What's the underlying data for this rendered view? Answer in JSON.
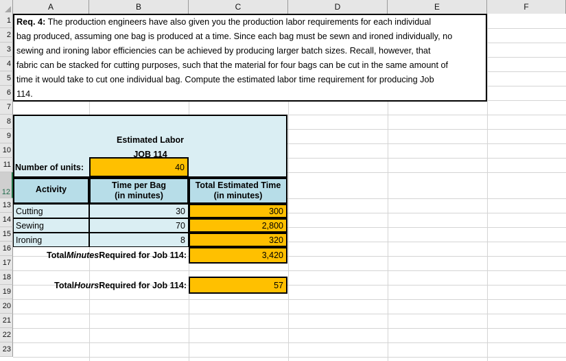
{
  "spreadsheet": {
    "column_headers": [
      "A",
      "B",
      "C",
      "D",
      "E",
      "F"
    ],
    "row_headers": [
      "1",
      "2",
      "3",
      "4",
      "5",
      "6",
      "7",
      "8",
      "9",
      "10",
      "11",
      "12",
      "13",
      "14",
      "15",
      "16",
      "17",
      "18",
      "19",
      "20",
      "21",
      "22",
      "23"
    ],
    "selected_row": "12",
    "colors": {
      "header_fill": "#E6E6E6",
      "selected_header_fill": "#CFCFCF",
      "selection_accent": "#217346",
      "light_blue_fill": "#DAEEF3",
      "mid_blue_fill": "#B7DDE8",
      "orange_fill": "#FFC000",
      "gridline": "#D4D4D4",
      "border": "#000000"
    }
  },
  "prompt": {
    "label": "Req. 4:",
    "lines": [
      "  The production engineers have also given you the production labor requirements for each individual",
      "bag produced, assuming one bag is produced at a time. Since each bag must be sewn and ironed individually, no",
      "sewing and ironing labor efficiencies can be achieved by producing larger batch sizes.  Recall, however, that",
      "fabric can be stacked for cutting purposes, such that the material for four bags can be cut in the same amount of",
      "time it would take to cut one individual bag.  Compute the estimated labor time requirement for producing Job",
      "114."
    ]
  },
  "table": {
    "title_line1": "Estimated Labor",
    "title_line2": "JOB 114",
    "units_label": "Number of units:",
    "units_value": "40",
    "headers": {
      "activity": "Activity",
      "time_per_bag_l1": "Time per Bag",
      "time_per_bag_l2": "(in minutes)",
      "total_time_l1": "Total Estimated Time",
      "total_time_l2": "(in minutes)"
    },
    "rows": [
      {
        "activity": "Cutting",
        "time_per_bag": "30",
        "total_time": "300"
      },
      {
        "activity": "Sewing",
        "time_per_bag": "70",
        "total_time": "2,800"
      },
      {
        "activity": "Ironing",
        "time_per_bag": "8",
        "total_time": "320"
      }
    ],
    "total_minutes": {
      "label_pre": "Total ",
      "label_em": "Minutes",
      "label_post": " Required for Job 114:",
      "value": "3,420"
    },
    "total_hours": {
      "label_pre": "Total ",
      "label_em": "Hours",
      "label_post": " Required for Job 114:",
      "value": "57"
    }
  }
}
